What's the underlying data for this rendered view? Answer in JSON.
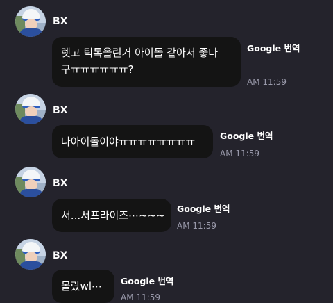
{
  "messages": [
    {
      "sender": "BX",
      "lines": [
        "렛고 틱톡올린거 아이돌 같아서 좋다",
        "구ㅠㅠㅠㅠㅠㅠ?"
      ],
      "translate_label": "Google 번역",
      "time": "AM 11:59"
    },
    {
      "sender": "BX",
      "lines": [
        "나아이돌이야ㅠㅠㅠㅠㅠㅠㅠㅠ"
      ],
      "translate_label": "Google 번역",
      "time": "AM 11:59"
    },
    {
      "sender": "BX",
      "lines": [
        "서...서프라이즈⋯~~~"
      ],
      "translate_label": "Google 번역",
      "time": "AM 11:59"
    },
    {
      "sender": "BX",
      "lines": [
        "몰랐wl⋯"
      ],
      "translate_label": "Google 번역",
      "time": "AM 11:59"
    }
  ],
  "colors": {
    "background": "#24232c",
    "bubble": "#141414",
    "time": "#9a9aab"
  },
  "icons": [
    "avatar-photo"
  ]
}
